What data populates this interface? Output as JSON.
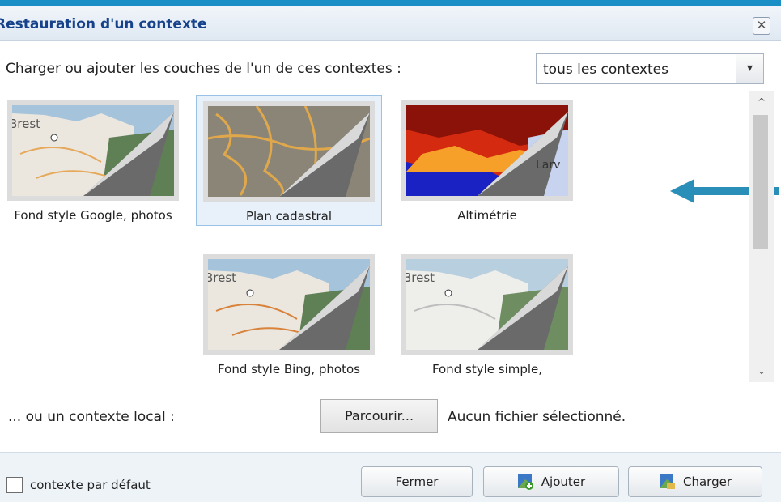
{
  "window": {
    "title": "Restauration d'un contexte",
    "close_glyph": "✕"
  },
  "intro": {
    "text": "Charger ou ajouter les couches de l'un de ces contextes :"
  },
  "filter": {
    "selected": "tous les contextes",
    "arrow_glyph": "▾"
  },
  "contexts": [
    {
      "label": "Fond style Google, photos",
      "map_text": "Brest",
      "selected": false
    },
    {
      "label": "Plan cadastral",
      "map_text": "",
      "selected": true
    },
    {
      "label": "Altimétrie",
      "map_text": "Larv",
      "selected": false
    },
    {
      "label": "Fond style Bing, photos",
      "map_text": "Brest",
      "selected": false
    },
    {
      "label": "Fond style simple,",
      "map_text": "Brest",
      "selected": false
    }
  ],
  "scroll": {
    "up_glyph": "^",
    "down_glyph": "⌄"
  },
  "local": {
    "label": "... ou un contexte local :",
    "browse_label": "Parcourir...",
    "file_status": "Aucun fichier sélectionné."
  },
  "footer": {
    "default_label": "contexte par défaut",
    "close_label": "Fermer",
    "add_label": "Ajouter",
    "load_label": "Charger"
  },
  "colors": {
    "accent": "#1a8fc6",
    "title": "#15428b",
    "arrow": "#2a8fb8"
  }
}
